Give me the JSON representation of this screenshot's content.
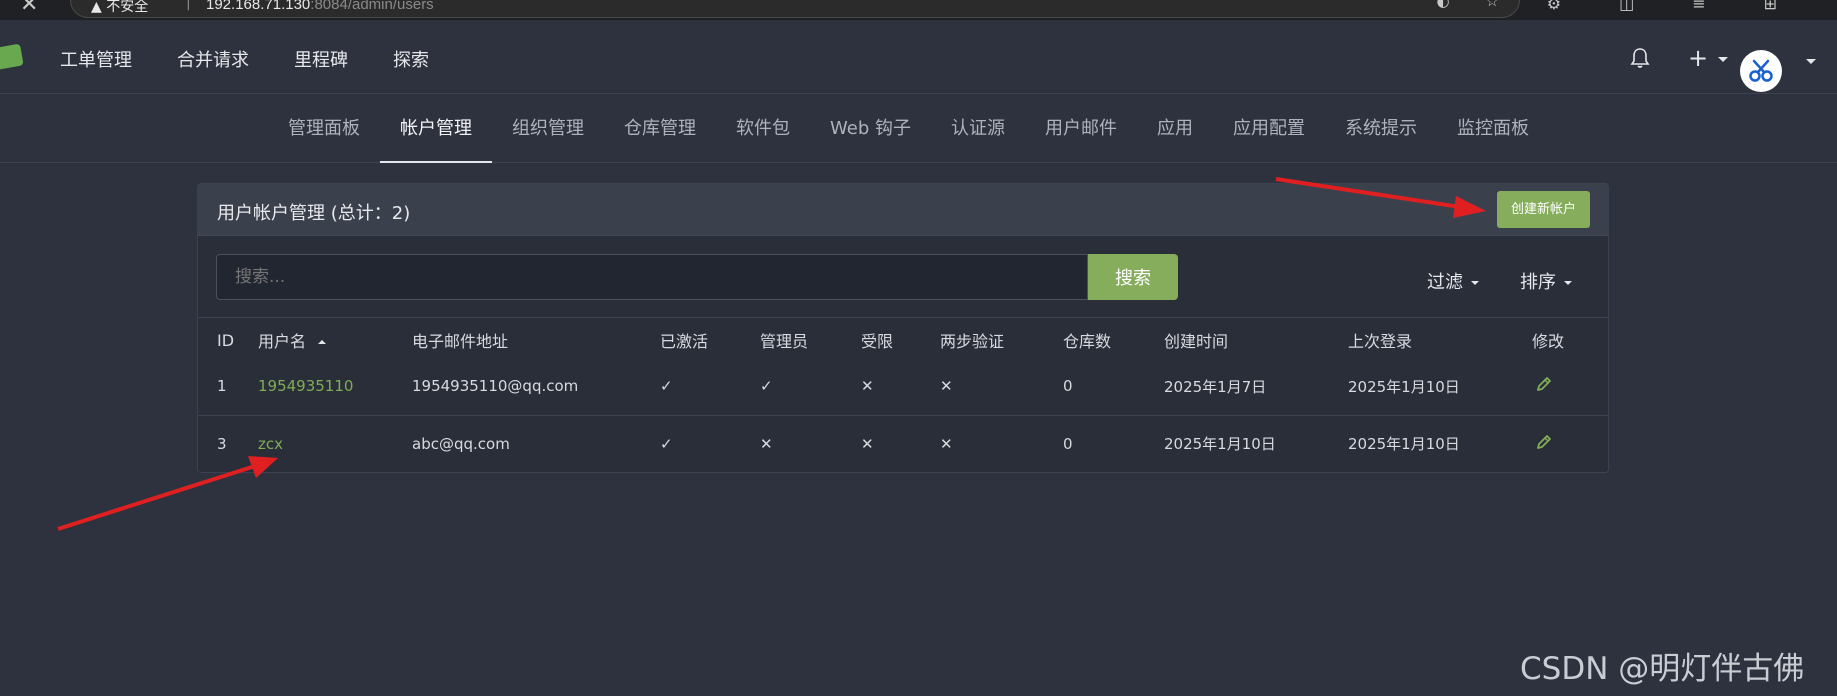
{
  "browser": {
    "security_label": "不安全",
    "url_host": "192.168.71.130",
    "url_path": ":8084/admin/users"
  },
  "topnav": {
    "items": [
      "工单管理",
      "合并请求",
      "里程碑",
      "探索"
    ]
  },
  "admin_tabs": [
    "管理面板",
    "帐户管理",
    "组织管理",
    "仓库管理",
    "软件包",
    "Web 钩子",
    "认证源",
    "用户邮件",
    "应用",
    "应用配置",
    "系统提示",
    "监控面板"
  ],
  "panel": {
    "title": "用户帐户管理 (总计：2)",
    "create_button": "创建新帐户",
    "search_placeholder": "搜索...",
    "search_button": "搜索",
    "filter_label": "过滤",
    "sort_label": "排序"
  },
  "table": {
    "headers": [
      "ID",
      "用户名",
      "电子邮件地址",
      "已激活",
      "管理员",
      "受限",
      "两步验证",
      "仓库数",
      "创建时间",
      "上次登录",
      "修改"
    ],
    "rows": [
      {
        "id": "1",
        "username": "1954935110",
        "email": "1954935110@qq.com",
        "activated": "✓",
        "admin": "✓",
        "restricted": "✕",
        "two_factor": "✕",
        "repos": "0",
        "created": "2025年1月7日",
        "last_login": "2025年1月10日"
      },
      {
        "id": "3",
        "username": "zcx",
        "email": "abc@qq.com",
        "activated": "✓",
        "admin": "✕",
        "restricted": "✕",
        "two_factor": "✕",
        "repos": "0",
        "created": "2025年1月10日",
        "last_login": "2025年1月10日"
      }
    ]
  },
  "watermark": "CSDN @明灯伴古佛",
  "colors": {
    "accent_green": "#86ad5c",
    "link_green": "#7fae56",
    "annotation_red": "#e02020"
  }
}
